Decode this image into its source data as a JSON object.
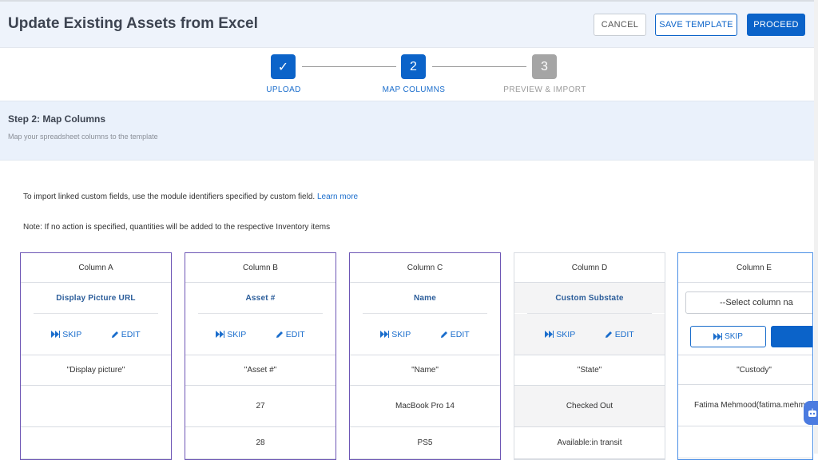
{
  "header": {
    "title": "Update Existing Assets from Excel",
    "cancel_label": "CANCEL",
    "save_label": "SAVE TEMPLATE",
    "proceed_label": "PROCEED"
  },
  "stepper": {
    "steps": [
      {
        "number": "✓",
        "label": "UPLOAD",
        "state": "done"
      },
      {
        "number": "2",
        "label": "MAP COLUMNS",
        "state": "active"
      },
      {
        "number": "3",
        "label": "PREVIEW & IMPORT",
        "state": "pending"
      }
    ]
  },
  "step_header": {
    "title": "Step 2: Map Columns",
    "subtitle": "Map your spreadsheet columns to the template"
  },
  "info": {
    "linked_text": "To import linked custom fields, use the module identifiers specified by custom field.",
    "learn_more": "Learn more",
    "note": "Note: If no action is specified, quantities will be added to the respective Inventory items"
  },
  "actions": {
    "skip_label": "SKIP",
    "edit_label": "EDIT"
  },
  "columns": [
    {
      "title": "Column A",
      "field": "Display Picture URL",
      "header_value": "\"Display picture\"",
      "values": [
        "",
        ""
      ]
    },
    {
      "title": "Column B",
      "field": "Asset #",
      "header_value": "\"Asset #\"",
      "values": [
        "27",
        "28"
      ]
    },
    {
      "title": "Column C",
      "field": "Name",
      "header_value": "\"Name\"",
      "values": [
        "MacBook Pro 14",
        "PS5"
      ]
    },
    {
      "title": "Column D",
      "field": "Custom Substate",
      "header_value": "\"State\"",
      "values": [
        "Checked Out",
        "Available:in transit"
      ]
    }
  ],
  "column_e": {
    "title": "Column E",
    "select_placeholder": "--Select column na",
    "header_value": "\"Custody\"",
    "values": [
      "Fatima Mehmood(fatima.mehmoo",
      ""
    ]
  },
  "colors": {
    "primary": "#0b63c9",
    "mapped_border": "#6d56b5",
    "step_pending": "#a5a5a5"
  }
}
